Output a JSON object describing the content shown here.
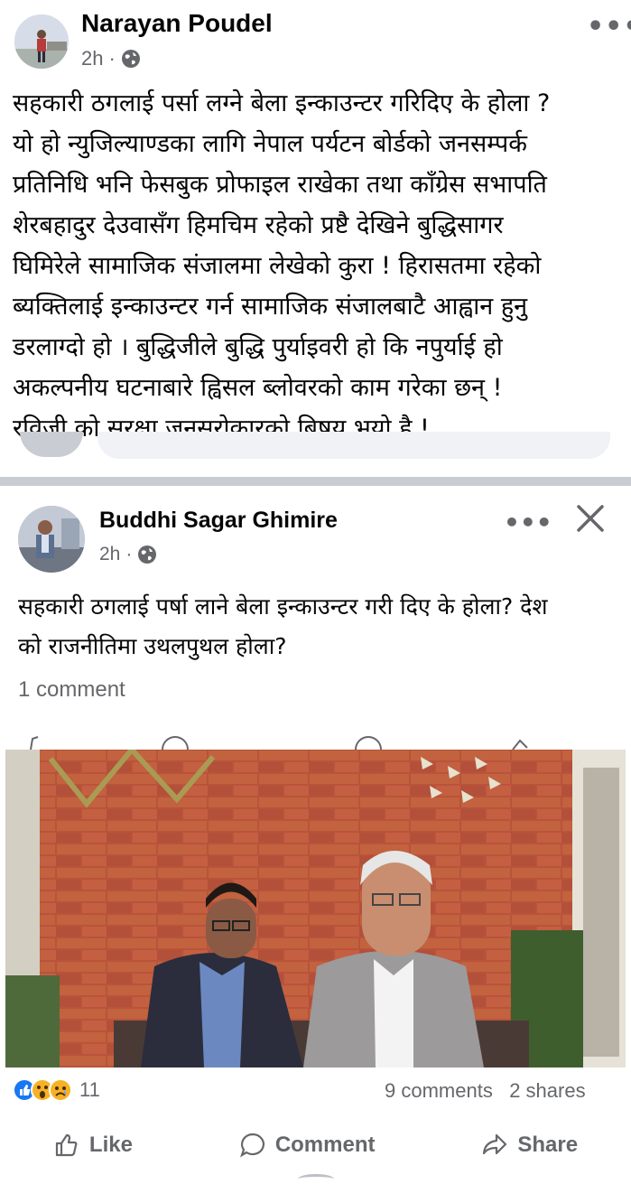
{
  "outer_post": {
    "author": "Narayan Poudel",
    "time": "2h",
    "more_icon": "ellipsis-icon",
    "privacy_icon": "globe-icon",
    "lines": [
      "सहकारी ठगलाई पर्सा लग्ने बेला इन्काउन्टर गरिदिए के होला ?",
      "यो हो न्युजिल्याण्डका लागि नेपाल पर्यटन बोर्डको जनसम्पर्क",
      "प्रतिनिधि भनि फेसबुक प्रोफाइल राखेका तथा काँग्रेस सभापति",
      "शेरबहादुर देउवासँग हिमचिम रहेको प्रष्टै देखिने बुद्धिसागर",
      "घिमिरेले सामाजिक संजालमा लेखेको कुरा ! हिरासतमा रहेको",
      "ब्यक्तिलाई इन्काउन्टर गर्न सामाजिक संजालबाटै आह्वान हुनु",
      "डरलाग्दो हो । बुद्धिजीले बुद्धि पुर्याइवरी हो कि नपुर्याई हो",
      "अकल्पनीय घटनाबारे ह्विसल ब्लोवरको काम गरेका छन् !",
      "रविजी को सुरक्षा जनसरोकारको बिषय भयो है !"
    ]
  },
  "shared_post": {
    "author": "Buddhi Sagar Ghimire",
    "time": "2h",
    "lines": [
      "सहकारी ठगलाई पर्षा लाने बेला इन्काउन्टर गरी दिए के होला? देश",
      "को राजनीतिमा उथलपुथल होला?"
    ],
    "comments": "1 comment"
  },
  "footer": {
    "reaction_count": "11",
    "comments": "9 comments",
    "shares": "2 shares",
    "like": "Like",
    "comment": "Comment",
    "share": "Share"
  },
  "colors": {
    "secondary_text": "#65676b",
    "like_blue": "#1877f2",
    "wow_yellow": "#f7b125",
    "divider": "#c9ccd1"
  }
}
